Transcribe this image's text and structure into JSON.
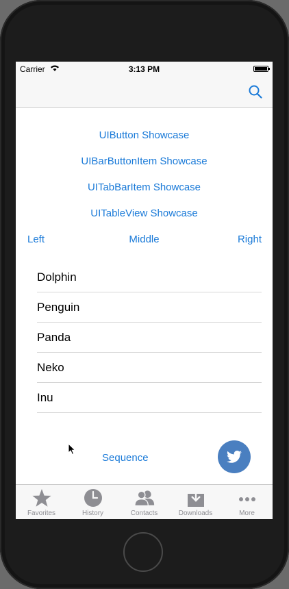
{
  "status_bar": {
    "carrier": "Carrier",
    "time": "3:13 PM"
  },
  "nav_bar": {
    "right_icon": "search-icon"
  },
  "showcase_links": {
    "button": "UIButton Showcase",
    "bar_button_item": "UIBarButtonItem Showcase",
    "tab_bar_item": "UITabBarItem Showcase",
    "table_view": "UITableView Showcase"
  },
  "alignment": {
    "left": "Left",
    "middle": "Middle",
    "right": "Right"
  },
  "animals": [
    "Dolphin",
    "Penguin",
    "Panda",
    "Neko",
    "Inu"
  ],
  "sequence_label": "Sequence",
  "floating_button_icon": "twitter-icon",
  "tab_bar": {
    "items": [
      {
        "label": "Favorites",
        "icon": "star-icon"
      },
      {
        "label": "History",
        "icon": "clock-icon"
      },
      {
        "label": "Contacts",
        "icon": "contacts-icon"
      },
      {
        "label": "Downloads",
        "icon": "download-icon"
      },
      {
        "label": "More",
        "icon": "more-icon"
      }
    ]
  },
  "colors": {
    "tint": "#1a7ad8",
    "tab_inactive": "#8e8e93",
    "twitter_button": "#4a7fc0"
  }
}
